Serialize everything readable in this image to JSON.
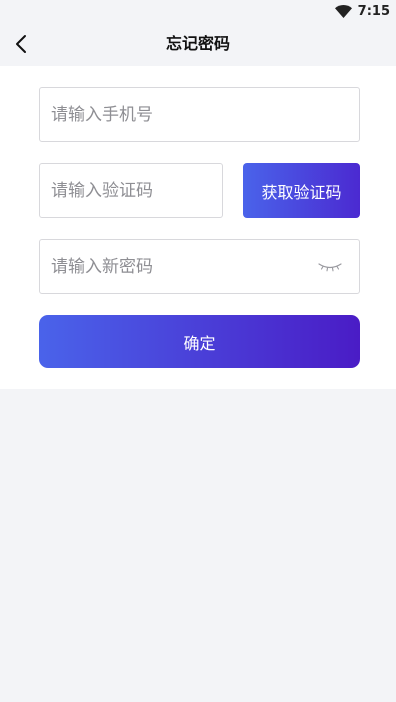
{
  "status_bar": {
    "time": "7:15",
    "wifi_icon": "wifi-icon"
  },
  "header": {
    "back_icon": "chevron-left-icon",
    "title": "忘记密码"
  },
  "form": {
    "phone_placeholder": "请输入手机号",
    "code_placeholder": "请输入验证码",
    "get_code_label": "获取验证码",
    "password_placeholder": "请输入新密码",
    "password_toggle_icon": "eye-closed-icon",
    "confirm_label": "确定"
  },
  "colors": {
    "page_background": "#f3f4f7",
    "card_background": "#ffffff",
    "gradient_start": "#4a63ea",
    "gradient_end": "#4a1cc6"
  }
}
